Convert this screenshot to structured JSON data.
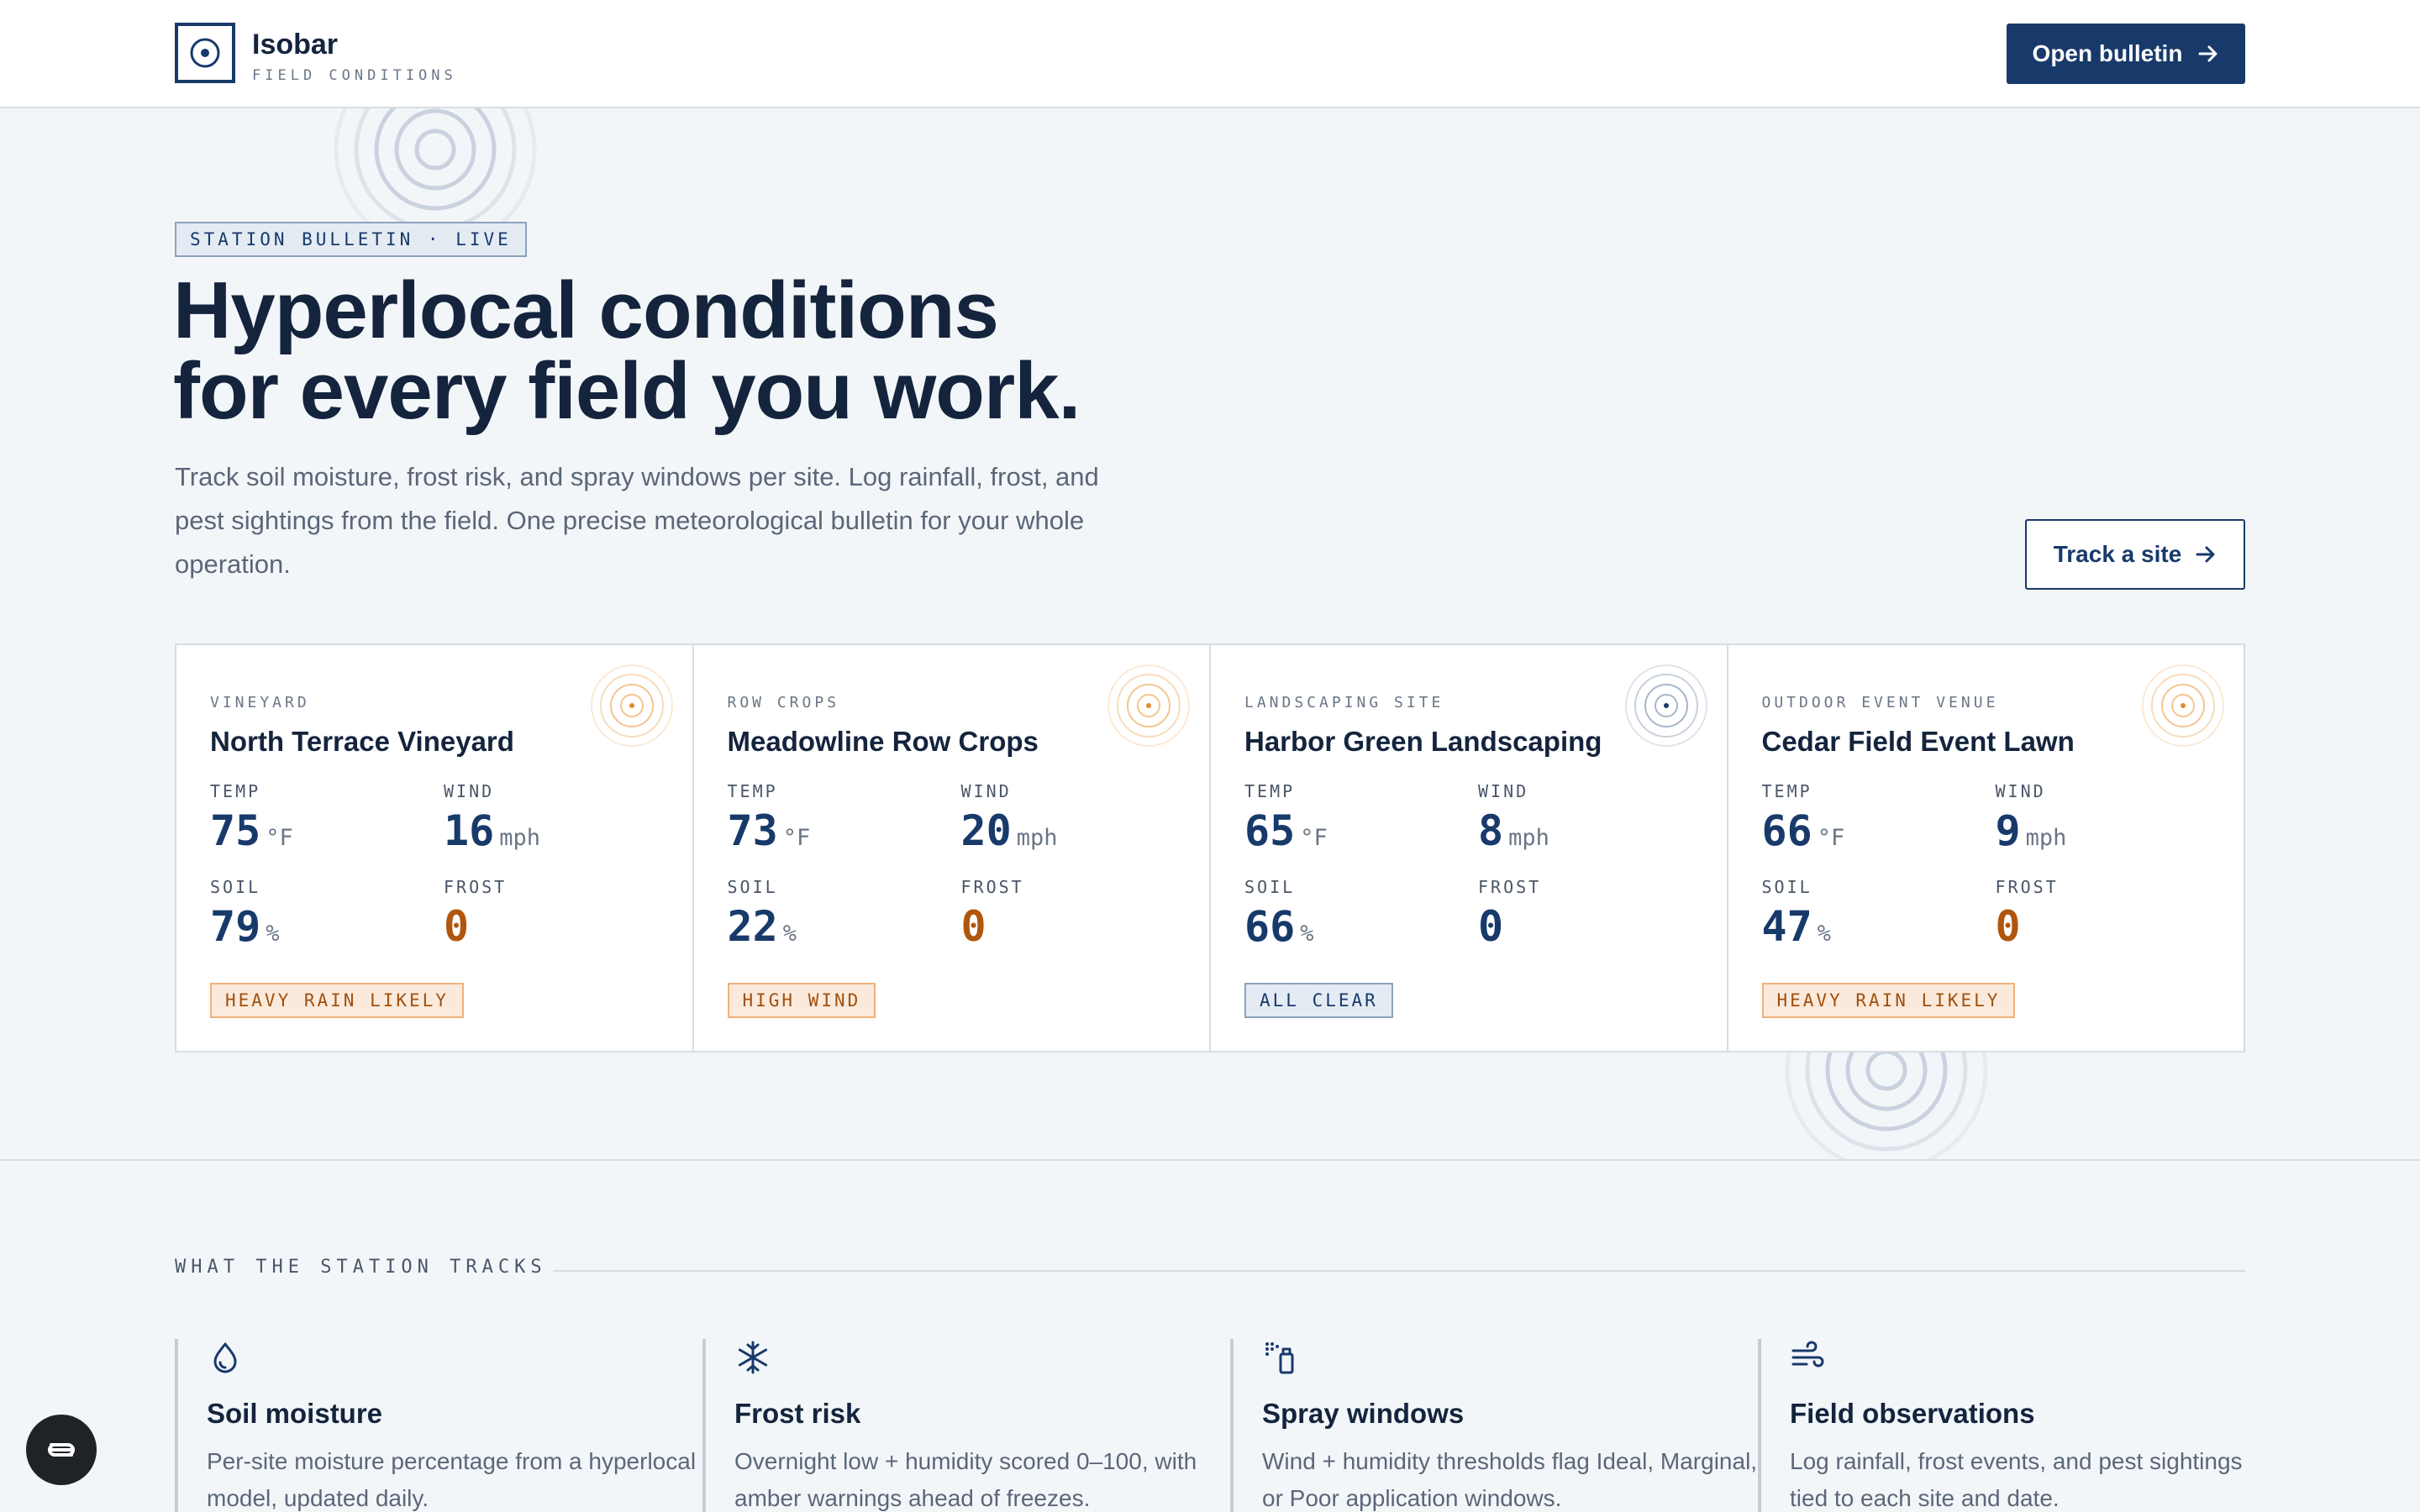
{
  "header": {
    "brand_name": "Isobar",
    "brand_sub": "FIELD CONDITIONS",
    "open_bulletin_label": "Open bulletin"
  },
  "hero": {
    "tag": "STATION BULLETIN · LIVE",
    "title_line1": "Hyperlocal conditions",
    "title_line2": "for every field you work.",
    "subtitle": "Track soil moisture, frost risk, and spray windows per site. Log rainfall, frost, and pest sightings from the field. One precise meteorological bulletin for your whole operation.",
    "track_label": "Track a site"
  },
  "labels": {
    "temp": "TEMP",
    "wind": "WIND",
    "soil": "SOIL",
    "frost": "FROST",
    "temp_unit": "°F",
    "wind_unit": "mph",
    "soil_unit": "%"
  },
  "sites": [
    {
      "kind": "VINEYARD",
      "name": "North Terrace Vineyard",
      "temp": "75",
      "wind": "16",
      "soil": "79",
      "frost": "0",
      "badge": "HEAVY RAIN LIKELY",
      "status": "warn"
    },
    {
      "kind": "ROW CROPS",
      "name": "Meadowline Row Crops",
      "temp": "73",
      "wind": "20",
      "soil": "22",
      "frost": "0",
      "badge": "HIGH WIND",
      "status": "warn"
    },
    {
      "kind": "LANDSCAPING SITE",
      "name": "Harbor Green Landscaping",
      "temp": "65",
      "wind": "8",
      "soil": "66",
      "frost": "0",
      "badge": "ALL CLEAR",
      "status": "ok"
    },
    {
      "kind": "OUTDOOR EVENT VENUE",
      "name": "Cedar Field Event Lawn",
      "temp": "66",
      "wind": "9",
      "soil": "47",
      "frost": "0",
      "badge": "HEAVY RAIN LIKELY",
      "status": "warn"
    }
  ],
  "tracks": {
    "heading": "WHAT THE STATION TRACKS",
    "features": [
      {
        "icon": "droplet-icon",
        "title": "Soil moisture",
        "desc": "Per-site moisture percentage from a hyperlocal model, updated daily."
      },
      {
        "icon": "snowflake-icon",
        "title": "Frost risk",
        "desc": "Overnight low + humidity scored 0–100, with amber warnings ahead of freezes."
      },
      {
        "icon": "spray-bottle-icon",
        "title": "Spray windows",
        "desc": "Wind + humidity thresholds flag Ideal, Marginal, or Poor application windows."
      },
      {
        "icon": "wind-icon",
        "title": "Field observations",
        "desc": "Log rainfall, frost events, and pest sightings tied to each site and date."
      }
    ]
  },
  "colors": {
    "navy": "#183a6b",
    "amber": "#b0560d",
    "background": "#f3f6f9"
  }
}
